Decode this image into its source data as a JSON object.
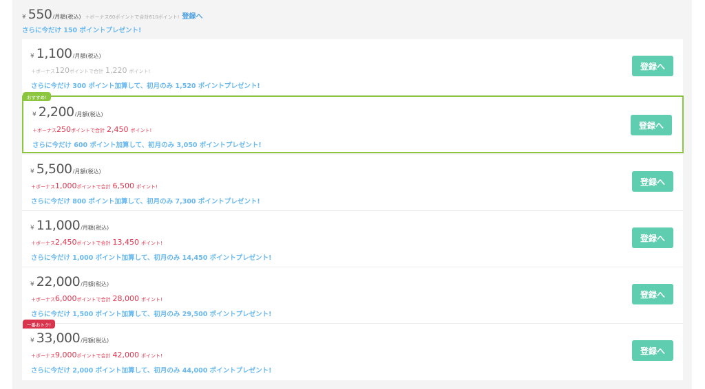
{
  "top_plan": {
    "yen": "¥",
    "price": "550",
    "unit": "/月額(税込)",
    "bonus_prefix": "＋ボーナス",
    "bonus_points": "60",
    "bonus_middle": "ポイントで合計",
    "total_points": "610",
    "bonus_suffix": "ポイント!",
    "register_link": "登録へ",
    "extra": "さらに今だけ 150 ポイントプレゼント!"
  },
  "plans": [
    {
      "yen": "¥",
      "price": "1,100",
      "unit": "/月額(税込)",
      "bonus_prefix": "＋ボーナス",
      "bonus_points": "120",
      "bonus_middle": "ポイントで合計",
      "total_points": "1,220",
      "bonus_suffix": "ポイント!",
      "extra": "さらに今だけ 300 ポイント加算して、初月のみ 1,520 ポイントプレゼント!",
      "button": "登録へ"
    },
    {
      "badge": "おすすめ!",
      "yen": "¥",
      "price": "2,200",
      "unit": "/月額(税込)",
      "bonus_prefix": "＋ボーナス",
      "bonus_points": "250",
      "bonus_middle": "ポイントで合計",
      "total_points": "2,450",
      "bonus_suffix": "ポイント!",
      "extra": "さらに今だけ 600 ポイント加算して、初月のみ 3,050 ポイントプレゼント!",
      "button": "登録へ"
    },
    {
      "yen": "¥",
      "price": "5,500",
      "unit": "/月額(税込)",
      "bonus_prefix": "＋ボーナス",
      "bonus_points": "1,000",
      "bonus_middle": "ポイントで合計",
      "total_points": "6,500",
      "bonus_suffix": "ポイント!",
      "extra": "さらに今だけ 800 ポイント加算して、初月のみ 7,300 ポイントプレゼント!",
      "button": "登録へ"
    },
    {
      "yen": "¥",
      "price": "11,000",
      "unit": "/月額(税込)",
      "bonus_prefix": "＋ボーナス",
      "bonus_points": "2,450",
      "bonus_middle": "ポイントで合計",
      "total_points": "13,450",
      "bonus_suffix": "ポイント!",
      "extra": "さらに今だけ 1,000 ポイント加算して、初月のみ 14,450 ポイントプレゼント!",
      "button": "登録へ"
    },
    {
      "yen": "¥",
      "price": "22,000",
      "unit": "/月額(税込)",
      "bonus_prefix": "＋ボーナス",
      "bonus_points": "6,000",
      "bonus_middle": "ポイントで合計",
      "total_points": "28,000",
      "bonus_suffix": "ポイント!",
      "extra": "さらに今だけ 1,500 ポイント加算して、初月のみ 29,500 ポイントプレゼント!",
      "button": "登録へ"
    },
    {
      "badge": "一番おトク!",
      "yen": "¥",
      "price": "33,000",
      "unit": "/月額(税込)",
      "bonus_prefix": "＋ボーナス",
      "bonus_points": "9,000",
      "bonus_middle": "ポイントで合計",
      "total_points": "42,000",
      "bonus_suffix": "ポイント!",
      "extra": "さらに今だけ 2,000 ポイント加算して、初月のみ 44,000 ポイントプレゼント!",
      "button": "登録へ"
    }
  ],
  "colors": {
    "button": "#5ecdb0",
    "recommended_border": "#8cc63f",
    "best_badge": "#d9344e",
    "bonus_text": "#e0334d",
    "extra_text": "#68b8ee"
  }
}
